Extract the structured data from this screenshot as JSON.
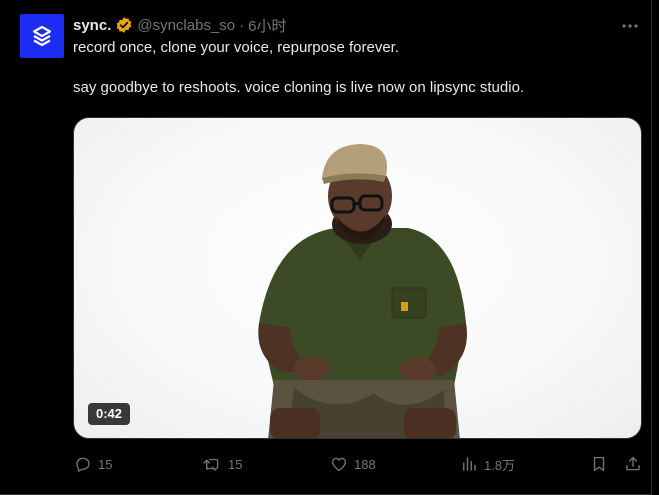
{
  "tweet": {
    "author_name": "sync.",
    "handle": "@synclabs_so",
    "separator": "·",
    "time": "6小时",
    "avatar_icon": "sync-logo-icon",
    "verified_icon": "verified-badge-icon",
    "verified_color": "#e8a317",
    "brand_color": "#1d2cf5",
    "text_lines": [
      "record once, clone your voice, repurpose forever.",
      "say goodbye to reshoots. voice cloning is live now on lipsync studio."
    ]
  },
  "media": {
    "type": "video",
    "duration": "0:42",
    "description_icon": "video-thumbnail"
  },
  "actions": {
    "reply": {
      "icon": "reply-icon",
      "count": "15"
    },
    "repost": {
      "icon": "repost-icon",
      "count": "15"
    },
    "like": {
      "icon": "heart-icon",
      "count": "188"
    },
    "views": {
      "icon": "views-chart-icon",
      "count": "1.8万"
    },
    "bookmark": {
      "icon": "bookmark-icon"
    },
    "share": {
      "icon": "share-icon"
    }
  },
  "colors": {
    "background": "#000000",
    "text_primary": "#e7e9ea",
    "text_secondary": "#71767b"
  }
}
